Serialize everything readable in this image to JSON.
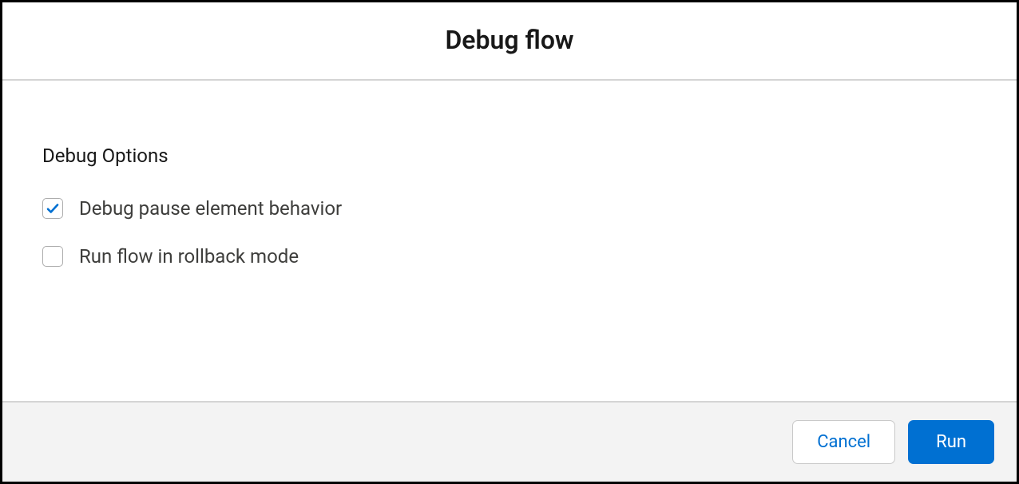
{
  "header": {
    "title": "Debug flow"
  },
  "section": {
    "title": "Debug Options"
  },
  "options": [
    {
      "label": "Debug pause element behavior",
      "checked": true
    },
    {
      "label": "Run flow in rollback mode",
      "checked": false
    }
  ],
  "footer": {
    "cancel_label": "Cancel",
    "run_label": "Run"
  }
}
